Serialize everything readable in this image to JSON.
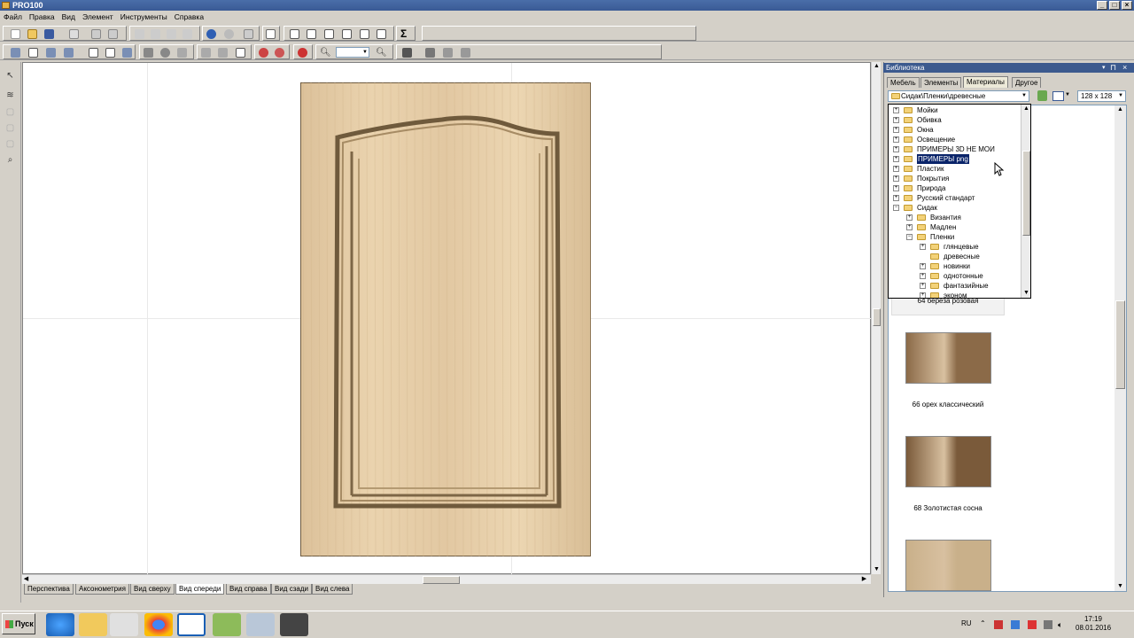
{
  "window": {
    "title": "PRO100"
  },
  "menu": [
    "Файл",
    "Правка",
    "Вид",
    "Элемент",
    "Инструменты",
    "Справка"
  ],
  "toolbar": {
    "zoom_value": ""
  },
  "view_tabs": [
    "Перспектива",
    "Аксонометрия",
    "Вид сверху",
    "Вид спереди",
    "Вид справа",
    "Вид сзади",
    "Вид слева"
  ],
  "active_view_tab": "Вид спереди",
  "library": {
    "title": "Библиотека",
    "tabs": [
      "Мебель",
      "Элементы",
      "Материалы",
      "Другое"
    ],
    "active_tab": "Материалы",
    "path": "Сидак\\Пленки\\древесные",
    "thumb_size": "128 x 128",
    "tree": [
      {
        "label": "Мойки",
        "level": 0,
        "expand": "+"
      },
      {
        "label": "Обивка",
        "level": 0,
        "expand": "+"
      },
      {
        "label": "Окна",
        "level": 0,
        "expand": "+"
      },
      {
        "label": "Освещение",
        "level": 0,
        "expand": "+"
      },
      {
        "label": "ПРИМЕРЫ 3D НЕ МОИ",
        "level": 0,
        "expand": "+"
      },
      {
        "label": "ПРИМЕРЫ png",
        "level": 0,
        "expand": "+",
        "selected": true
      },
      {
        "label": "Пластик",
        "level": 0,
        "expand": "+"
      },
      {
        "label": "Покрытия",
        "level": 0,
        "expand": "+"
      },
      {
        "label": "Природа",
        "level": 0,
        "expand": "+"
      },
      {
        "label": "Русский стандарт",
        "level": 0,
        "expand": "+"
      },
      {
        "label": "Сидак",
        "level": 0,
        "expand": "−"
      },
      {
        "label": "Византия",
        "level": 1,
        "expand": "+"
      },
      {
        "label": "Мадлен",
        "level": 1,
        "expand": "+"
      },
      {
        "label": "Пленки",
        "level": 1,
        "expand": "−"
      },
      {
        "label": "глянцевые",
        "level": 2,
        "expand": "+"
      },
      {
        "label": "древесные",
        "level": 2,
        "expand": ""
      },
      {
        "label": "новинки",
        "level": 2,
        "expand": "+"
      },
      {
        "label": "однотонные",
        "level": 2,
        "expand": "+"
      },
      {
        "label": "фантазийные",
        "level": 2,
        "expand": "+"
      },
      {
        "label": "эконом",
        "level": 2,
        "expand": "+"
      }
    ],
    "materials": [
      {
        "label": "64 береза розовая",
        "color": "#e6c9a8"
      },
      {
        "label": "66 орех классический",
        "color": "#8b6a48"
      },
      {
        "label": "68 Золотистая сосна",
        "color": "#7a5a3a"
      },
      {
        "label": "",
        "color": "#c9b08a"
      }
    ]
  },
  "taskbar": {
    "start_label": "Пуск",
    "lang": "RU",
    "time": "17:19",
    "date": "08.01.2016"
  },
  "colors": {
    "wood_light": "#e6cfaa",
    "wood_dark": "#8a7150",
    "title_blue": "#3c5a8e"
  }
}
